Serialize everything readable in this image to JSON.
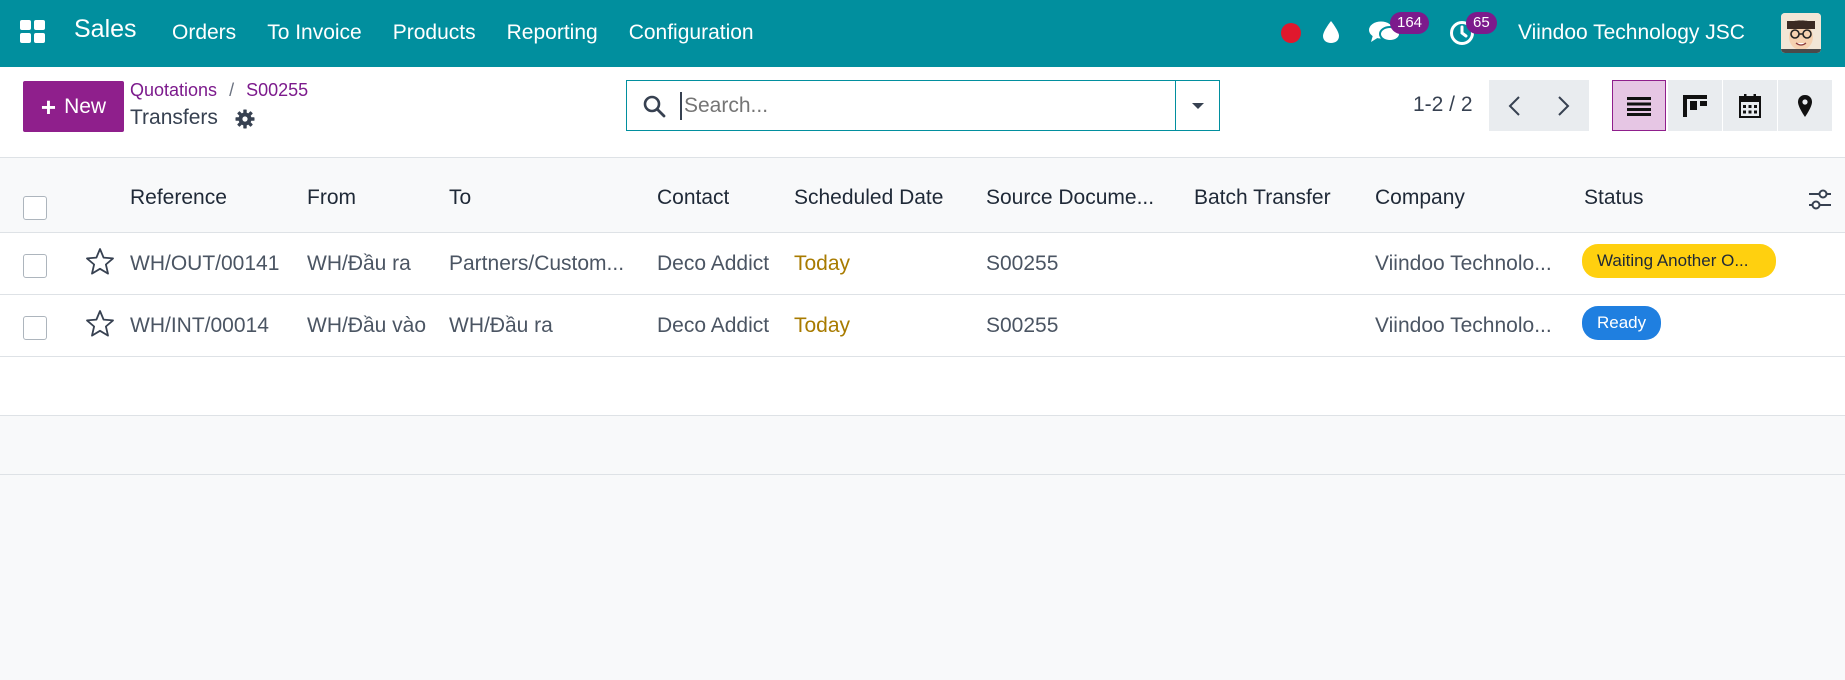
{
  "navbar": {
    "brand": "Sales",
    "menu": [
      "Orders",
      "To Invoice",
      "Products",
      "Reporting",
      "Configuration"
    ],
    "chat_count": "164",
    "activity_count": "65",
    "company": "Viindoo Technology JSC"
  },
  "control": {
    "new_label": "New",
    "breadcrumb": [
      "Quotations",
      "S00255"
    ],
    "breadcrumb_sep": "/",
    "title": "Transfers",
    "search_placeholder": "Search...",
    "pager": "1-2 / 2"
  },
  "columns": [
    "Reference",
    "From",
    "To",
    "Contact",
    "Scheduled Date",
    "Source Docume...",
    "Batch Transfer",
    "Company",
    "Status"
  ],
  "rows": [
    {
      "reference": "WH/OUT/00141",
      "from": "WH/Đầu ra",
      "to": "Partners/Custom...",
      "contact": "Deco Addict",
      "scheduled": "Today",
      "source": "S00255",
      "batch": "",
      "company": "Viindoo Technolo...",
      "status": "Waiting Another O..."
    },
    {
      "reference": "WH/INT/00014",
      "from": "WH/Đầu vào",
      "to": "WH/Đầu ra",
      "contact": "Deco Addict",
      "scheduled": "Today",
      "source": "S00255",
      "batch": "",
      "company": "Viindoo Technolo...",
      "status": "Ready"
    }
  ],
  "colors": {
    "navbar": "#018f9e",
    "primary": "#8f1f8c",
    "warning": "#ffd00f",
    "ready": "#1f7fe0",
    "today": "#a87b00"
  }
}
